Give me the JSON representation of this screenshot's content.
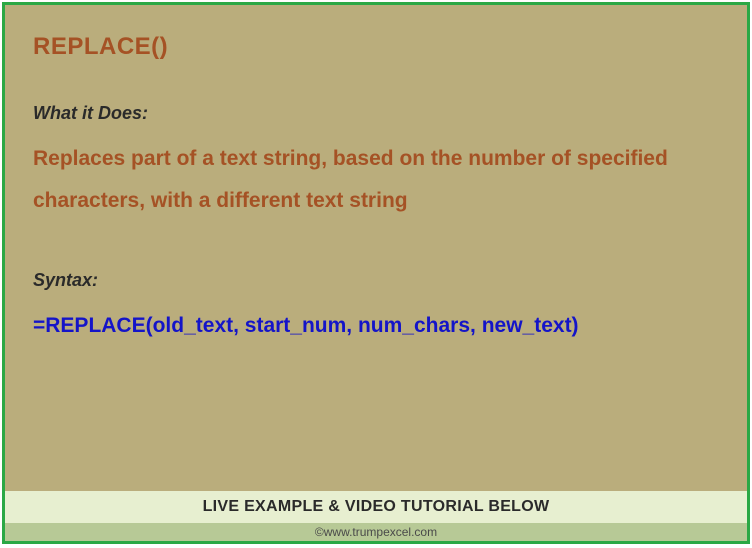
{
  "title": "REPLACE()",
  "whatItDoesLabel": "What it Does:",
  "description": "Replaces part of a text string, based on the number of specified characters, with a different text string",
  "syntaxLabel": "Syntax:",
  "syntax": "=REPLACE(old_text, start_num, num_chars, new_text)",
  "banner": "LIVE EXAMPLE & VIDEO TUTORIAL BELOW",
  "footer": "©www.trumpexcel.com"
}
